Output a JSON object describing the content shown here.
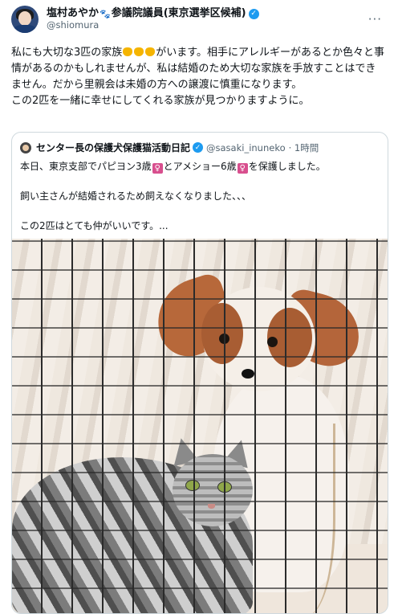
{
  "post": {
    "author_name_prefix": "塩村あやか",
    "author_name_suffix": "参議院議員(東京選挙区候補)",
    "paw_glyph": "🐾",
    "verified_glyph": "✓",
    "handle": "@shiomura",
    "more_glyph": "···",
    "text_part1": "私にも大切な3匹の家族",
    "text_part2": "がいます。相手にアレルギーがあるとか色々と事情があるのかもしれませんが、私は結婚のため大切な家族を手放すことはできません。だから里親会は未婚の方への譲渡に慎重になります。\nこの2匹を一緒に幸せにしてくれる家族が見つかりますように。"
  },
  "quote": {
    "author_name": "センター長の保護犬保護猫活動日記",
    "verified_glyph": "✓",
    "handle": "@sasaki_inuneko",
    "time": "· 1時間",
    "line1_a": "本日、東京支部でパピヨン3歳",
    "line1_b": "とアメショー6歳",
    "line1_c": "を保護しました。",
    "female_glyph": "♀",
    "line2": "飼い主さんが結婚されるため飼えなくなりました、、、",
    "line3": "この2匹はとても仲がいいです。..."
  },
  "photo": {
    "subject": "papillon-dog-and-american-shorthair-cat-in-cage"
  },
  "colors": {
    "verified": "#1d9bf0",
    "female_badge": "#d84f8e",
    "handle_gray": "#536471",
    "border": "#cfd9de"
  }
}
